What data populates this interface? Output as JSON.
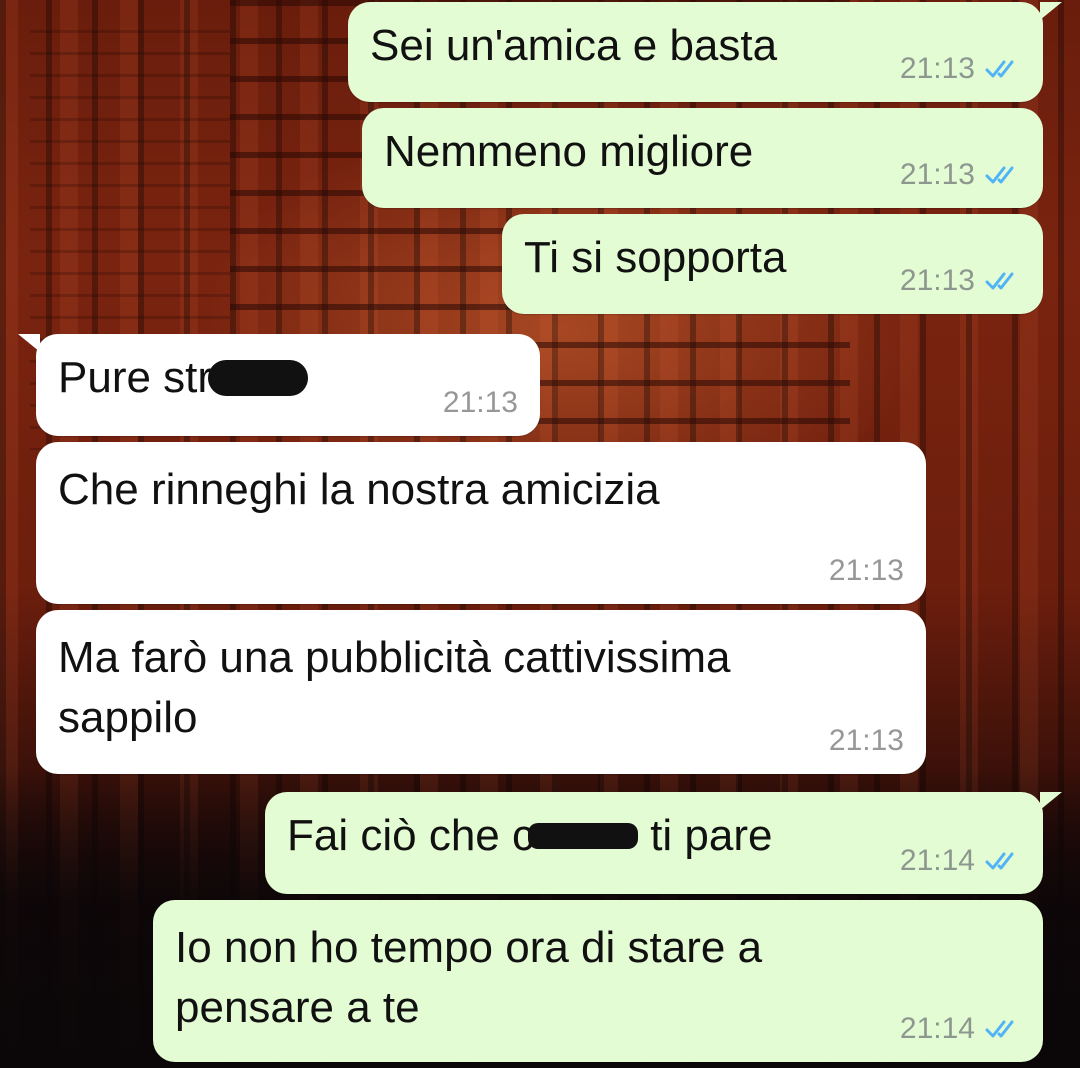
{
  "messages": [
    {
      "direction": "outgoing",
      "text": "Sei un'amica e basta",
      "time": "21:13",
      "status": "read"
    },
    {
      "direction": "outgoing",
      "text": "Nemmeno migliore",
      "time": "21:13",
      "status": "read"
    },
    {
      "direction": "outgoing",
      "text": "Ti si sopporta",
      "time": "21:13",
      "status": "read"
    },
    {
      "direction": "incoming",
      "text_before": "Pure str",
      "text_after": "",
      "redacted": true,
      "time": "21:13"
    },
    {
      "direction": "incoming",
      "text": "Che rinneghi la nostra amicizia",
      "time": "21:13"
    },
    {
      "direction": "incoming",
      "lines": [
        "Ma farò una pubblicità cattivissima",
        "sappilo"
      ],
      "time": "21:13"
    },
    {
      "direction": "outgoing",
      "text_before": "Fai ciò che c",
      "text_after": " ti pare",
      "redacted": true,
      "time": "21:14",
      "status": "read"
    },
    {
      "direction": "outgoing",
      "lines": [
        "Io non ho tempo ora di stare a",
        "pensare a te"
      ],
      "time": "21:14",
      "status": "read"
    }
  ],
  "colors": {
    "outgoing_bubble": "#e3fcd3",
    "incoming_bubble": "#ffffff",
    "read_tick": "#4fb3f6",
    "timestamp": "#8d978f"
  },
  "icons": {
    "read_receipt": "double-check-icon",
    "redaction": "redaction-mark"
  },
  "background": "red torii gates corridor wallpaper"
}
